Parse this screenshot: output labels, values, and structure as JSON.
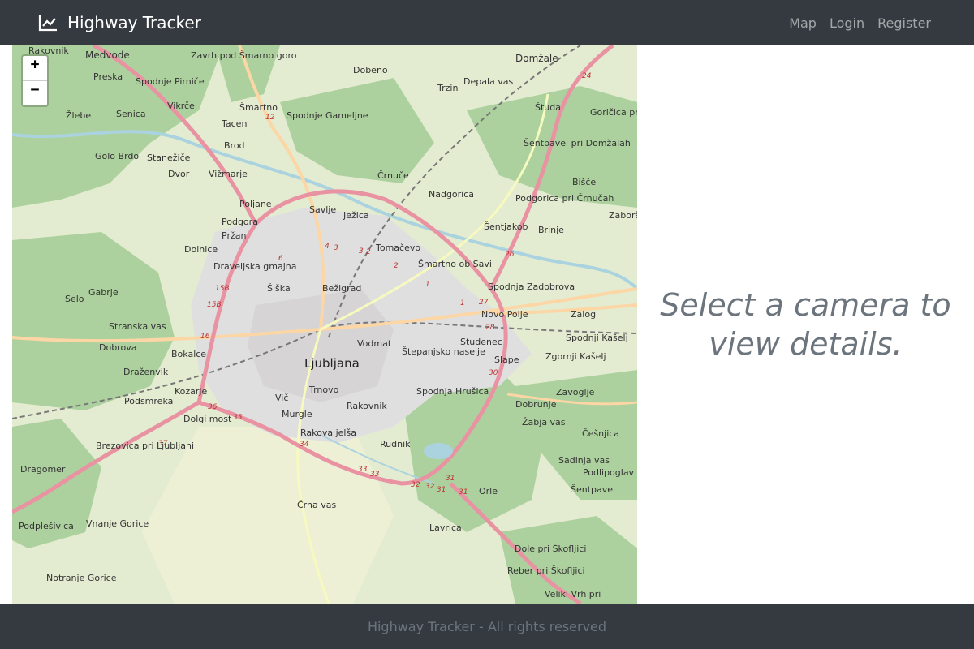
{
  "navbar": {
    "brand": "Highway Tracker",
    "links": [
      "Map",
      "Login",
      "Register"
    ]
  },
  "map": {
    "zoom_in": "+",
    "zoom_out": "−",
    "center_label": "Ljubljana",
    "places": [
      "Rakovnik",
      "Medvode",
      "Zavrh pod Šmarno goro",
      "Preska",
      "Spodnje Pirniče",
      "Dobeno",
      "Trzin",
      "Depala vas",
      "Domžale",
      "Vikrče",
      "Šmartno",
      "Spodnje Gameljne",
      "Študa",
      "Goričica pri Ihanu",
      "Senica",
      "Žlebe",
      "Tacen",
      "Šentpavel pri Domžalah",
      "Golo Brdo",
      "Stanežiče",
      "Brod",
      "Dvor",
      "Vižmarje",
      "Črnuče",
      "Bišče",
      "Nadgorica",
      "Podgorica pri Črnučah",
      "Poljane",
      "Savlje",
      "Ježica",
      "Zaboršt",
      "Podgora",
      "Šentjakob",
      "Brinje",
      "Tomačevo",
      "Dolnice",
      "Pržan",
      "Draveljska gmajna",
      "Šmartno ob Savi",
      "Šiška",
      "Bežigrad",
      "Spodnja Zadobrova",
      "Gabrje",
      "Selo",
      "Novo Polje",
      "Zalog",
      "Stranska vas",
      "Spodnji Kašelj",
      "Dobrova",
      "Bokalce",
      "Vodmat",
      "Štepanjsko naselje",
      "Studenec",
      "Slape",
      "Zgornji Kašelj",
      "Draženvik",
      "Kozarje",
      "Trnovo",
      "Spodnja Hrušica",
      "Dobrunje",
      "Zavoglje",
      "Podsmreka",
      "Vič",
      "Rakovnik",
      "Dolgi most",
      "Murgle",
      "Žabja vas",
      "Češnjica",
      "Rakova jelša",
      "Rudnik",
      "Brezovica pri Ljubljani",
      "Sadinja vas",
      "Dragomer",
      "Podlipoglav",
      "Šentpavel",
      "Orle",
      "Črna vas",
      "Podplešivica",
      "Vnanje Gorice",
      "Lavrica",
      "Dole pri Škofljici",
      "Notranje Gorice",
      "Reber pri Škofljici",
      "Veliki Vrh pri"
    ],
    "road_numbers": [
      "12",
      "24",
      "4",
      "3",
      "3",
      "2",
      "6",
      "2",
      "1",
      "1",
      "27",
      "26",
      "28",
      "15B",
      "15B",
      "16",
      "30",
      "36",
      "35",
      "37",
      "34",
      "33",
      "33",
      "32",
      "32",
      "31",
      "31",
      "31"
    ]
  },
  "details": {
    "message": "Select a camera to view details."
  },
  "footer": {
    "text": "Highway Tracker - All rights reserved"
  },
  "colors": {
    "navbar_bg": "#343a40",
    "footer_text": "#6c757d",
    "motorway": "#e892a2",
    "primary_road": "#fcd6a4",
    "forest": "#add19e",
    "urban": "#e0dfdf"
  }
}
